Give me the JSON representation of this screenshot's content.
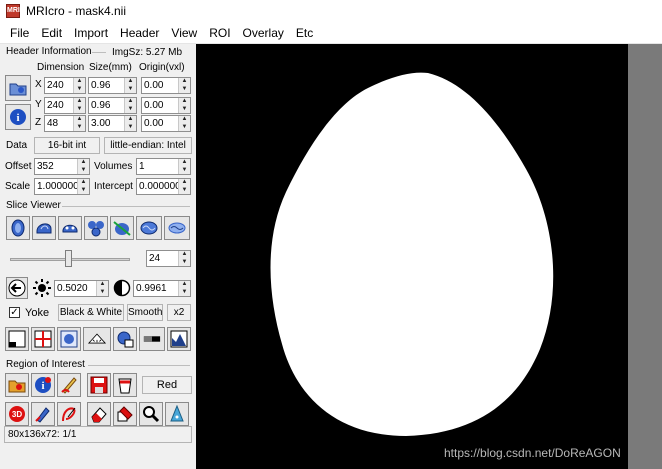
{
  "window": {
    "title": "MRIcro - mask4.nii",
    "app_icon": "MRI"
  },
  "menu": [
    "File",
    "Edit",
    "Import",
    "Header",
    "View",
    "ROI",
    "Overlay",
    "Etc"
  ],
  "header_info": {
    "label": "Header Information",
    "img_size": "ImgSz: 5.27 Mb",
    "col_dimension": "Dimension",
    "col_size": "Size(mm)",
    "col_origin": "Origin(vxl)",
    "rows": [
      {
        "axis": "X",
        "dim": "240",
        "size": "0.96",
        "origin": "0.00"
      },
      {
        "axis": "Y",
        "dim": "240",
        "size": "0.96",
        "origin": "0.00"
      },
      {
        "axis": "Z",
        "dim": "48",
        "size": "3.00",
        "origin": "0.00"
      }
    ],
    "data_label": "Data",
    "data_type": "16-bit int",
    "endian": "little-endian: Intel",
    "offset_label": "Offset",
    "offset_value": "352",
    "volumes_label": "Volumes",
    "volumes_value": "1",
    "scale_label": "Scale",
    "scale_value": "1.000000",
    "intercept_label": "Intercept",
    "intercept_value": "0.000000"
  },
  "slice_viewer": {
    "label": "Slice Viewer",
    "slice_value": "24",
    "brightness_value": "0.5020",
    "contrast_value": "0.9961",
    "slider_position": 0.49,
    "yoke_label": "Yoke",
    "yoke_checked": true,
    "bw_label": "Black & White",
    "smooth_label": "Smooth",
    "zoom_label": "x2"
  },
  "roi": {
    "label": "Region of Interest",
    "color_label": "Red"
  },
  "status": "80x136x72: 1/1",
  "watermark": "https://blog.csdn.net/DoReAGON"
}
